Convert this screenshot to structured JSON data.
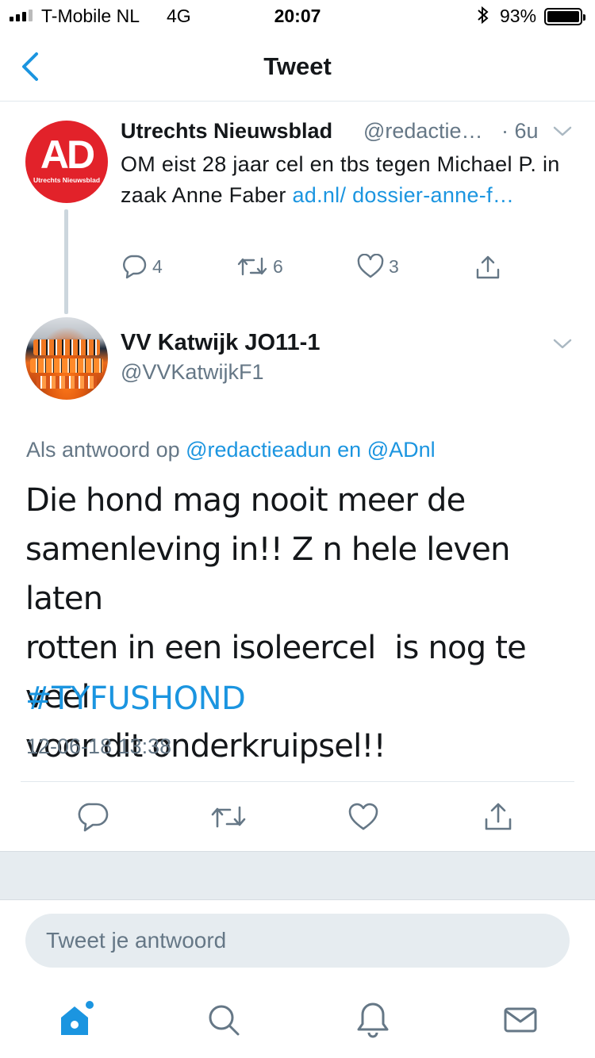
{
  "status_bar": {
    "carrier": "T-Mobile NL",
    "network": "4G",
    "time": "20:07",
    "battery_percent": "93%"
  },
  "nav": {
    "title": "Tweet"
  },
  "parent_tweet": {
    "name": "Utrechts Nieuwsblad",
    "handle": "@redactie…",
    "time": "· 6u",
    "avatar_text": "AD",
    "avatar_subtext": "Utrechts Nieuwsblad",
    "text": "OM eist 28 jaar cel en tbs tegen Michael P. in zaak Anne Faber ",
    "link": "ad.nl/ dossier-anne-f…",
    "reply_count": "4",
    "retweet_count": "6",
    "like_count": "3"
  },
  "main_tweet": {
    "name": "VV Katwijk JO11-1",
    "handle": "@VVKatwijkF1",
    "reply_prefix": "Als antwoord op ",
    "reply_user1": "@redactieadun",
    "reply_joiner": " en ",
    "reply_user2": "@ADnl",
    "text": "Die hond mag nooit meer de\nsamenleving in!! Z n hele leven laten\nrotten in een isoleercel  is nog te veel\nvoor dit onderkruipsel!!",
    "hashtag": "#TYFUSHOND",
    "timestamp": "12-06-18 13:38"
  },
  "reply_box": {
    "placeholder": "Tweet je antwoord"
  },
  "colors": {
    "accent": "#1b95e0",
    "ad_red": "#e2222a",
    "secondary_text": "#657786"
  },
  "icons": {
    "back": "chevron-left-icon",
    "reply": "speech-bubble-icon",
    "retweet": "retweet-icon",
    "like": "heart-icon",
    "share": "share-icon",
    "home": "home-icon",
    "search": "search-icon",
    "notifications": "bell-icon",
    "messages": "envelope-icon"
  }
}
